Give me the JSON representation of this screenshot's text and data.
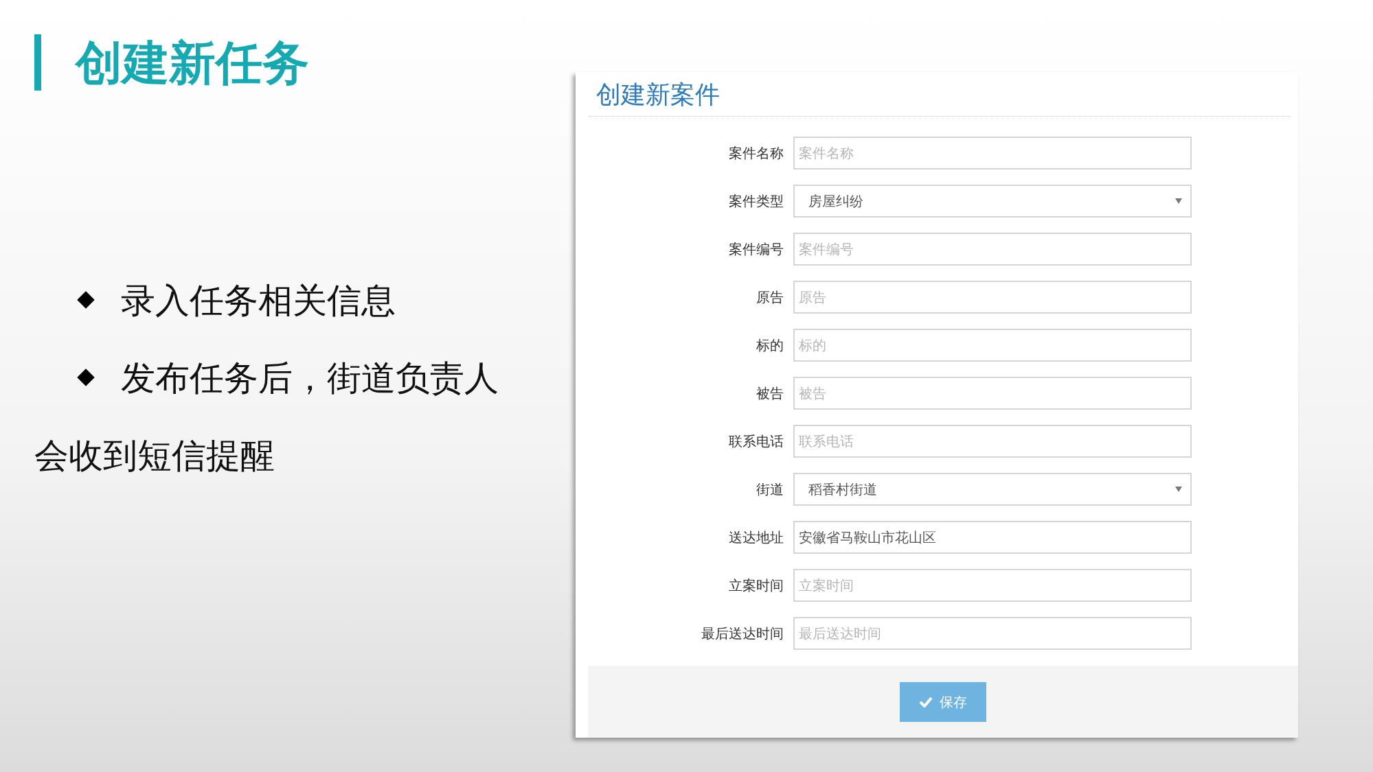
{
  "slide": {
    "title": "创建新任务",
    "bullets": [
      {
        "text": "录入任务相关信息"
      },
      {
        "text": "发布任务后，街道负责人",
        "continuation": "会收到短信提醒"
      }
    ]
  },
  "form": {
    "title": "创建新案件",
    "fields": [
      {
        "kind": "input",
        "label": "案件名称",
        "placeholder": "案件名称"
      },
      {
        "kind": "select",
        "label": "案件类型",
        "value": "房屋纠纷"
      },
      {
        "kind": "input",
        "label": "案件编号",
        "placeholder": "案件编号"
      },
      {
        "kind": "input",
        "label": "原告",
        "placeholder": "原告"
      },
      {
        "kind": "input",
        "label": "标的",
        "placeholder": "标的"
      },
      {
        "kind": "input",
        "label": "被告",
        "placeholder": "被告"
      },
      {
        "kind": "input",
        "label": "联系电话",
        "placeholder": "联系电话"
      },
      {
        "kind": "select",
        "label": "街道",
        "value": "稻香村街道"
      },
      {
        "kind": "input",
        "label": "送达地址",
        "value": "安徽省马鞍山市花山区"
      },
      {
        "kind": "input",
        "label": "立案时间",
        "placeholder": "立案时间"
      },
      {
        "kind": "input",
        "label": "最后送达时间",
        "placeholder": "最后送达时间"
      }
    ],
    "save_button": "保存"
  }
}
